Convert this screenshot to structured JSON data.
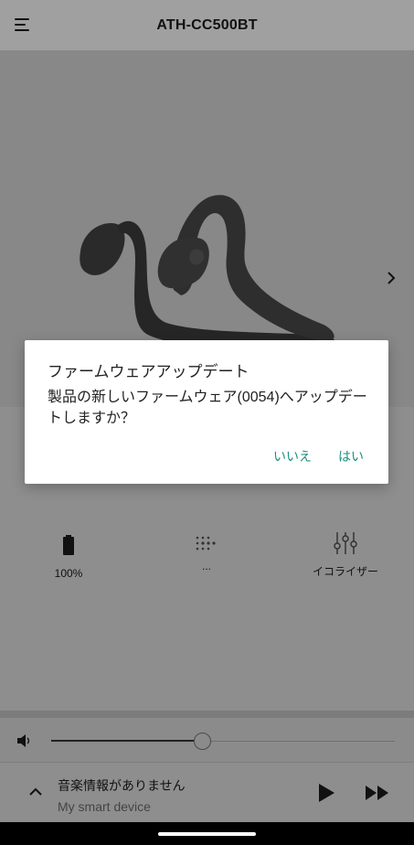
{
  "header": {
    "title": "ATH-CC500BT",
    "menu_icon": "hamburger-menu-icon"
  },
  "hero": {
    "product_image": "bone-conduction-headphones",
    "next_icon": "chevron-right-icon"
  },
  "stats": [
    {
      "icon": "battery-icon",
      "label": "100%"
    },
    {
      "icon": "dots-grid-icon",
      "label": "..."
    },
    {
      "icon": "equalizer-sliders-icon",
      "label": "イコライザー"
    }
  ],
  "volume": {
    "icon": "speaker-icon",
    "level": 0.44
  },
  "player": {
    "title": "音楽情報がありません",
    "source": "My smart device",
    "expand_icon": "chevron-up-icon",
    "play_icon": "play-icon",
    "next_icon": "fast-forward-icon"
  },
  "dialog": {
    "title": "ファームウェアアップデート",
    "message": "製品の新しいファームウェア(0054)へアップデートしますか？",
    "no_label": "いいえ",
    "yes_label": "はい"
  },
  "colors": {
    "accent": "#1a8f80",
    "overlay": "#8a8b8b"
  }
}
